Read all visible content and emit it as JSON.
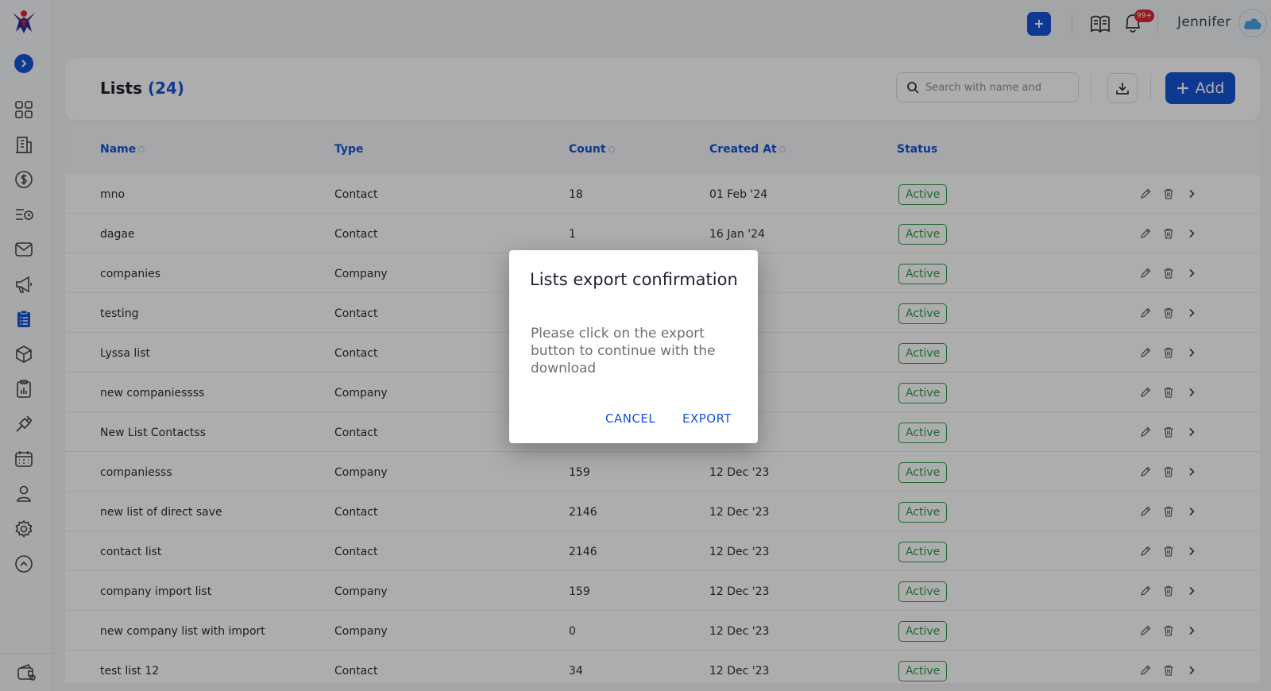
{
  "topbar": {
    "user_name": "Jennifer",
    "notification_badge": "99+"
  },
  "header": {
    "title": "Lists",
    "count": "(24)",
    "search_placeholder": "Search with name and",
    "add_label": "Add"
  },
  "table": {
    "columns": [
      "Name",
      "Type",
      "Count",
      "Created At",
      "Status"
    ],
    "rows": [
      {
        "name": "mno",
        "type": "Contact",
        "count": "18",
        "created": "01 Feb '24",
        "status": "Active"
      },
      {
        "name": "dagae",
        "type": "Contact",
        "count": "1",
        "created": "16 Jan '24",
        "status": "Active"
      },
      {
        "name": "companies",
        "type": "Company",
        "count": "",
        "created": "",
        "status": "Active"
      },
      {
        "name": "testing",
        "type": "Contact",
        "count": "",
        "created": "",
        "status": "Active"
      },
      {
        "name": "Lyssa list",
        "type": "Contact",
        "count": "",
        "created": "",
        "status": "Active"
      },
      {
        "name": "new companiessss",
        "type": "Company",
        "count": "",
        "created": "",
        "status": "Active"
      },
      {
        "name": "New List Contactss",
        "type": "Contact",
        "count": "",
        "created": "",
        "status": "Active"
      },
      {
        "name": "companiesss",
        "type": "Company",
        "count": "159",
        "created": "12 Dec '23",
        "status": "Active"
      },
      {
        "name": "new list of direct save",
        "type": "Contact",
        "count": "2146",
        "created": "12 Dec '23",
        "status": "Active"
      },
      {
        "name": "contact list",
        "type": "Contact",
        "count": "2146",
        "created": "12 Dec '23",
        "status": "Active"
      },
      {
        "name": "company import list",
        "type": "Company",
        "count": "159",
        "created": "12 Dec '23",
        "status": "Active"
      },
      {
        "name": "new company list with import",
        "type": "Company",
        "count": "0",
        "created": "12 Dec '23",
        "status": "Active"
      },
      {
        "name": "test list 12",
        "type": "Contact",
        "count": "34",
        "created": "12 Dec '23",
        "status": "Active"
      }
    ]
  },
  "modal": {
    "title": "Lists export confirmation",
    "body": "Please click on the export button to continue with the download",
    "cancel_label": "CANCEL",
    "export_label": "EXPORT"
  },
  "colors": {
    "accent": "#1554d6",
    "status_active": "#2f9a4b",
    "badge": "#e0262d"
  },
  "sidebar": {
    "icons": [
      "dashboard-icon",
      "building-icon",
      "dollar-icon",
      "tasks-icon",
      "mail-icon",
      "megaphone-icon",
      "lists-icon",
      "box-icon",
      "report-icon",
      "plug-icon",
      "calendar-icon",
      "user-icon",
      "gear-icon",
      "chevron-up-circle-icon",
      "wallet-icon"
    ]
  }
}
